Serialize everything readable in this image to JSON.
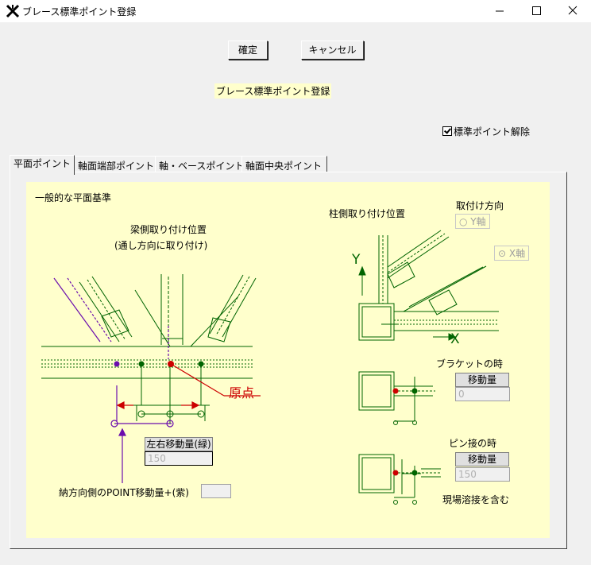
{
  "window": {
    "title": "ブレース標準ポイント登録"
  },
  "toolbar": {
    "ok_label": "確定",
    "cancel_label": "キャンセル"
  },
  "main_label": "ブレース標準ポイント登録",
  "release_checkbox": {
    "label": "標準ポイント解除",
    "checked": true
  },
  "tabs": [
    {
      "label": "平面ポイント",
      "active": true
    },
    {
      "label": "軸面端部ポイント",
      "active": false
    },
    {
      "label": "軸・ベースポイント",
      "active": false
    },
    {
      "label": "軸面中央ポイント",
      "active": false
    }
  ],
  "plan": {
    "section_title": "一般的な平面基準",
    "beam_mount_title": "梁側取り付け位置",
    "beam_mount_subtitle": "(通し方向に取り付け)",
    "origin_label": "原点",
    "lr_shift_header": "左右移動量(緑)",
    "lr_shift_value": "150",
    "purple_point_label": "納方向側のPOINT移動量+(紫)",
    "purple_point_value": ""
  },
  "column": {
    "mount_title": "柱側取り付け位置",
    "direction_title": "取付け方向",
    "y_axis_option": "Y軸",
    "x_axis_option": "X軸",
    "y_axis_label": "Y",
    "x_axis_label": "X",
    "bracket_title": "ブラケットの時",
    "bracket_shift_header": "移動量",
    "bracket_shift_value": "0",
    "pin_title": "ピン接の時",
    "pin_shift_header": "移動量",
    "pin_shift_value": "150",
    "site_weld_note": "現場溶接を含む"
  },
  "colors": {
    "canvas_bg": "#ffffcc",
    "green": "#006400",
    "red": "#cc0000",
    "purple": "#6a0dad"
  }
}
